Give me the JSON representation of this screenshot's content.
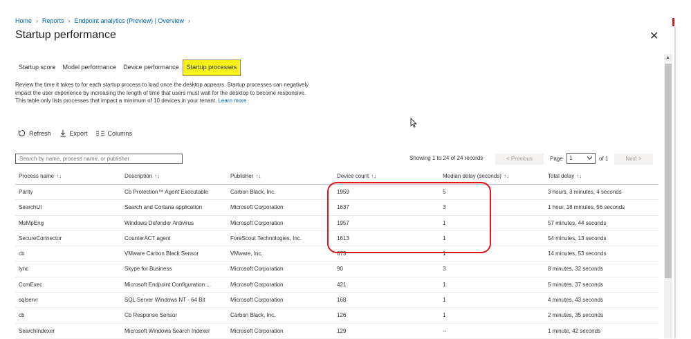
{
  "breadcrumb": [
    "Home",
    "Reports",
    "Endpoint analytics (Preview) | Overview",
    ""
  ],
  "page_title": "Startup performance",
  "close_glyph": "✕",
  "tabs": [
    {
      "label": "Startup score",
      "active": false
    },
    {
      "label": "Model performance",
      "active": false
    },
    {
      "label": "Device performance",
      "active": false
    },
    {
      "label": "Startup processes",
      "active": true
    }
  ],
  "description": "Review the time it takes to for each startup process to load once the desktop appears. Startup processes can negatively impact the user experience by increasing the length of time that users must wait for the desktop to become responsive. This table only lists processes that impact a minimum of 10 devices in your tenant.",
  "learn_more": "Learn more",
  "toolbar": {
    "refresh": "Refresh",
    "export": "Export",
    "columns": "Columns"
  },
  "search": {
    "placeholder": "Search by name, process name, or publisher"
  },
  "pagination": {
    "showing": "Showing 1 to 24 of 24 records",
    "previous": "< Previous",
    "page_label": "Page",
    "page_value": "1",
    "of_label": "of 1",
    "next": "Next >"
  },
  "columns": [
    "Process name",
    "Description",
    "Publisher",
    "Device count",
    "Median delay (seconds)",
    "Total delay"
  ],
  "sort_glyph": "↑↓",
  "rows": [
    [
      "Parity",
      "Cb Protection™ Agent Executable",
      "Carbon Black, Inc.",
      "1959",
      "5",
      "3 hours, 3 minutes, 4 seconds"
    ],
    [
      "SearchUI",
      "Search and Cortana application",
      "Microsoft Corporation",
      "1637",
      "3",
      "1 hour, 18 minutes, 56 seconds"
    ],
    [
      "MsMpEng",
      "Windows Defender Antivirus",
      "Microsoft Corporation",
      "1957",
      "1",
      "57 minutes, 44 seconds"
    ],
    [
      "SecureConnector",
      "CounterACT agent",
      "ForeScout Technologies, Inc.",
      "1613",
      "1",
      "54 minutes, 13 seconds"
    ],
    [
      "cb",
      "VMware Carbon Black Sensor",
      "VMware, Inc.",
      "673",
      "1",
      "14 minutes, 53 seconds"
    ],
    [
      "lync",
      "Skype for Business",
      "Microsoft Corporation",
      "90",
      "3",
      "8 minutes, 32 seconds"
    ],
    [
      "CcmExec",
      "Microsoft Endpoint Configuration ...",
      "Microsoft Corporation",
      "421",
      "1",
      "5 minutes, 37 seconds"
    ],
    [
      "sqlservr",
      "SQL Server Windows NT - 64 Bit",
      "Microsoft Corporation",
      "168",
      "1",
      "4 minutes, 43 seconds"
    ],
    [
      "cb",
      "Cb Response Sensor",
      "Carbon Black, Inc.",
      "126",
      "1",
      "2 minutes, 35 seconds"
    ],
    [
      "SearchIndexer",
      "Microsoft Windows Search Indexer",
      "Microsoft Corporation",
      "129",
      "--",
      "1 minute, 42 seconds"
    ]
  ],
  "colors": {
    "active_tab": "#f9f21a",
    "highlight": "#e0121a",
    "link": "#0063b1"
  }
}
